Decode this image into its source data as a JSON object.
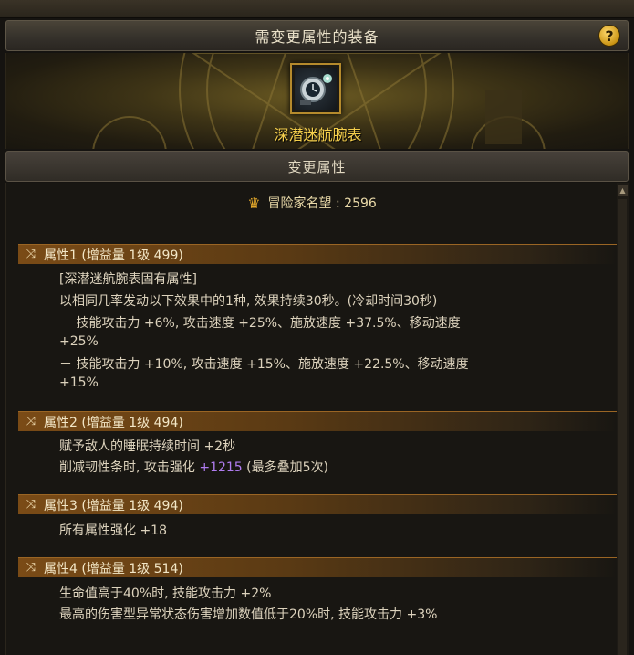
{
  "window": {
    "title": "需变更属性的装备",
    "help_label": "?"
  },
  "item": {
    "icon": "wristwatch-icon",
    "name": "深潜迷航腕表"
  },
  "section": {
    "title": "变更属性"
  },
  "renown": {
    "label": "冒险家名望 : 2596"
  },
  "attributes": [
    {
      "header": "属性1 (增益量 1级 499)",
      "lines": [
        "[深潜迷航腕表固有属性]",
        "以相同几率发动以下效果中的1种, 效果持续30秒。(冷却时间30秒)",
        "－ 技能攻击力 +6%, 攻击速度 +25%、施放速度 +37.5%、移动速度",
        "+25%",
        "－ 技能攻击力 +10%, 攻击速度 +15%、施放速度 +22.5%、移动速度",
        "+15%"
      ]
    },
    {
      "header": "属性2 (增益量 1级 494)",
      "lines": [
        "赋予敌人的睡眠持续时间 +2秒"
      ],
      "line2_prefix": "削减韧性条时, 攻击强化 ",
      "line2_highlight": "+1215",
      "line2_suffix": " (最多叠加5次)"
    },
    {
      "header": "属性3 (增益量 1级 494)",
      "lines": [
        "所有属性强化 +18"
      ]
    },
    {
      "header": "属性4 (增益量 1级 514)",
      "lines": [
        "生命值高于40%时, 技能攻击力 +2%",
        "最高的伤害型异常状态伤害增加数值低于20%时, 技能攻击力 +3%"
      ]
    }
  ],
  "colors": {
    "item_name": "#f5cf4c",
    "highlight": "#b07cf0",
    "header_bar": "#7a4b16"
  }
}
